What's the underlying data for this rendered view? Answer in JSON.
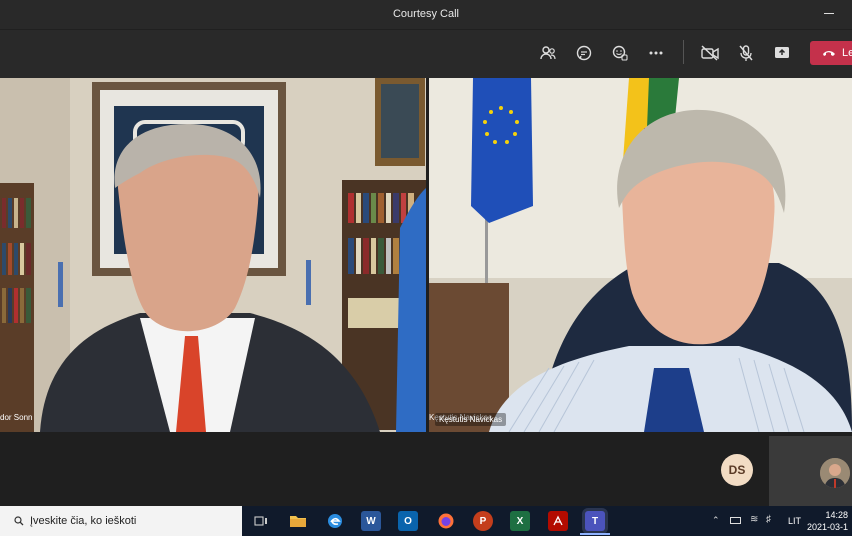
{
  "window": {
    "title": "Courtesy Call"
  },
  "toolbar": {
    "icons": [
      "participants-icon",
      "chat-icon",
      "reactions-icon",
      "more-icon",
      "camera-off-icon",
      "mic-off-icon",
      "share-icon"
    ],
    "leave_label": "Le",
    "leave_color": "#c4314b"
  },
  "participants": [
    {
      "name": "dor Sonn"
    },
    {
      "name": "Kęstutis Navickas"
    }
  ],
  "strip": {
    "avatar_initials": "DS"
  },
  "taskbar": {
    "search_placeholder": "Įveskite čia, ko ieškoti",
    "language": "LIT",
    "time": "14:28",
    "date": "2021-03-1"
  }
}
